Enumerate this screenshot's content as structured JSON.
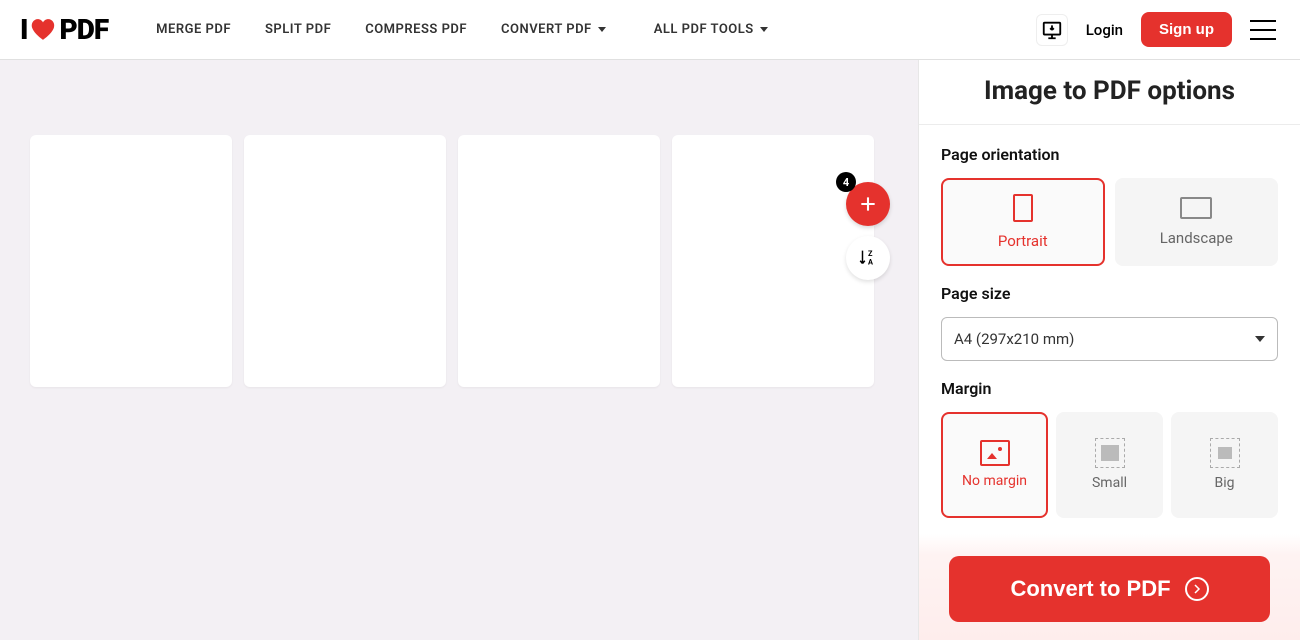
{
  "logo": {
    "prefix": "I",
    "suffix": "PDF"
  },
  "nav": {
    "merge": "MERGE PDF",
    "split": "SPLIT PDF",
    "compress": "COMPRESS PDF",
    "convert": "CONVERT PDF",
    "alltools": "ALL PDF TOOLS"
  },
  "header": {
    "login": "Login",
    "signup": "Sign up"
  },
  "canvas": {
    "file_count": "4"
  },
  "sidebar": {
    "title": "Image to PDF options",
    "orientation": {
      "label": "Page orientation",
      "portrait": "Portrait",
      "landscape": "Landscape"
    },
    "pagesize": {
      "label": "Page size",
      "value": "A4 (297x210 mm)"
    },
    "margin": {
      "label": "Margin",
      "none": "No margin",
      "small": "Small",
      "big": "Big"
    },
    "convert": "Convert to PDF"
  }
}
